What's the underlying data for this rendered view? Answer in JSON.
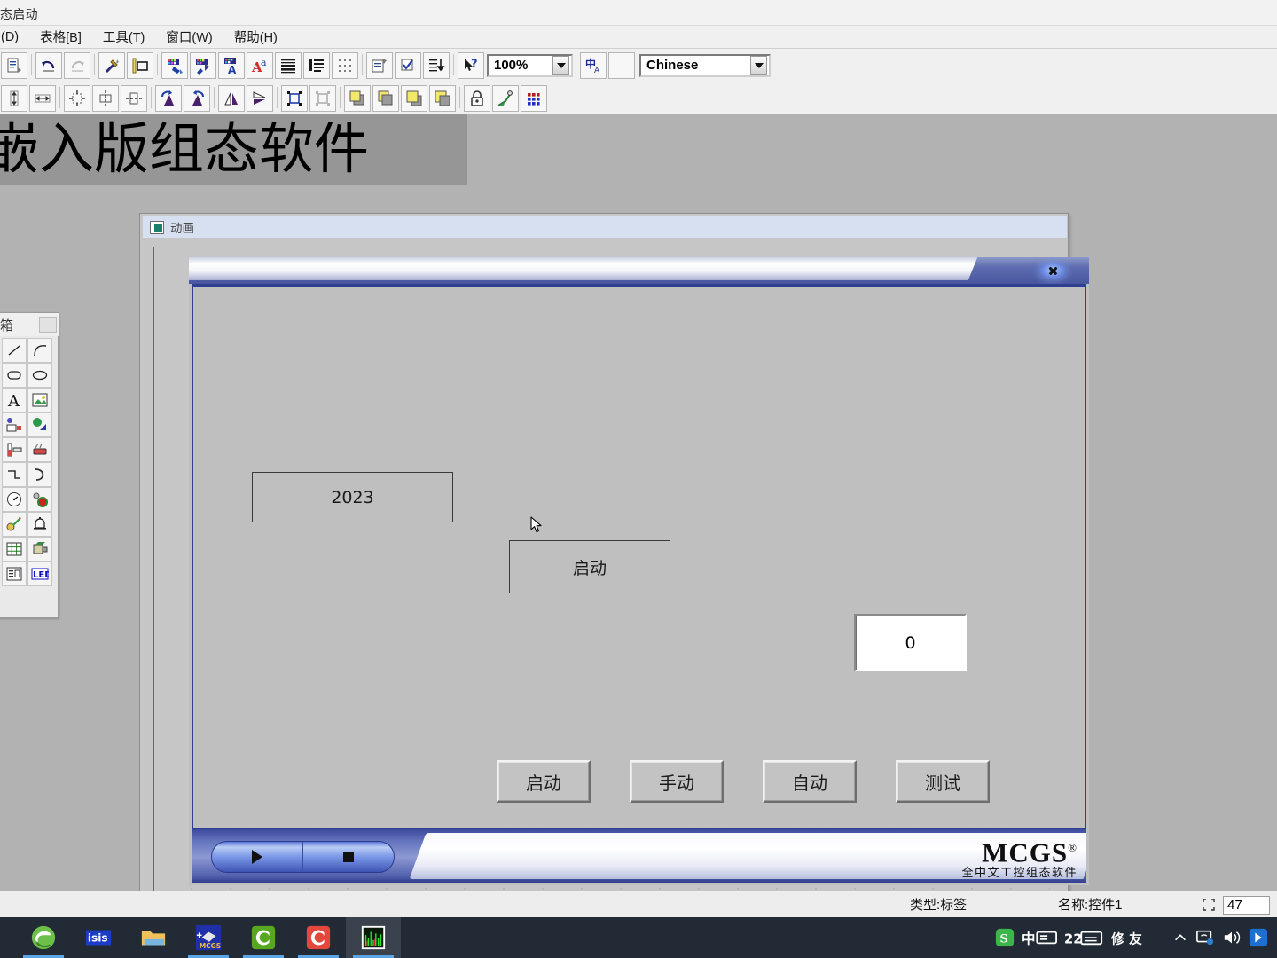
{
  "app": {
    "title": "态启动",
    "menu": [
      "(D)",
      "表格[B]",
      "工具(T)",
      "窗口(W)",
      "帮助(H)"
    ]
  },
  "toolbar": {
    "row1_icons": [
      "copy-page-icon",
      "undo-icon",
      "redo-icon",
      "tools-hammer-icon",
      "frame-ruler-icon",
      "fill-color-icon",
      "line-color-icon",
      "text-color-icon",
      "font-style-icon",
      "text-align-block-icon",
      "text-align-list-icon",
      "grid-dots-icon",
      "properties-icon",
      "check-script-icon",
      "sort-list-icon",
      "help-pointer-icon"
    ],
    "zoom_value": "100%",
    "ime_icon": "chinese-ime-icon",
    "language_value": "Chinese",
    "row2_icons": [
      "size-height-icon",
      "size-width-icon",
      "align-center-both-icon",
      "align-center-horizontal-icon",
      "align-center-vertical-icon",
      "rotate-left-icon",
      "rotate-right-icon",
      "flip-horizontal-icon",
      "flip-vertical-icon",
      "group-icon",
      "ungroup-icon",
      "bring-front-icon",
      "send-back-icon",
      "bring-forward-icon",
      "send-backward-icon",
      "lock-icon",
      "unlock-icon",
      "color-palette-icon"
    ]
  },
  "banner": {
    "text": "嵌入版组态软件"
  },
  "editor_window": {
    "icon": "animation-window-icon",
    "title": "动画"
  },
  "toolbox": {
    "title": "具箱",
    "items": [
      {
        "name": "line-tool",
        "glyph": "line-icon"
      },
      {
        "name": "arc-tool",
        "glyph": "arc-icon"
      },
      {
        "name": "rounded-rect-tool",
        "glyph": "rounded-rect-icon"
      },
      {
        "name": "ellipse-tool",
        "glyph": "ellipse-icon"
      },
      {
        "name": "text-tool",
        "glyph": "letter-a-icon"
      },
      {
        "name": "picture-tool",
        "glyph": "picture-icon"
      },
      {
        "name": "input-box-tool",
        "glyph": "input-box-icon"
      },
      {
        "name": "flow-block-tool",
        "glyph": "flow-block-icon"
      },
      {
        "name": "slider-tool",
        "glyph": "slider-icon"
      },
      {
        "name": "tank-tool",
        "glyph": "tank-icon"
      },
      {
        "name": "pipe-tool",
        "glyph": "pipe-icon"
      },
      {
        "name": "elbow-tool",
        "glyph": "elbow-icon"
      },
      {
        "name": "meter-tool",
        "glyph": "meter-icon"
      },
      {
        "name": "indicator-lamp-tool",
        "glyph": "lamp-icon"
      },
      {
        "name": "valve-tool",
        "glyph": "valve-icon"
      },
      {
        "name": "alarm-bell-tool",
        "glyph": "bell-icon"
      },
      {
        "name": "table-tool",
        "glyph": "table-icon"
      },
      {
        "name": "motor-tool",
        "glyph": "motor-icon"
      },
      {
        "name": "report-tool",
        "glyph": "report-icon"
      },
      {
        "name": "led-display-tool",
        "glyph": "led-icon"
      }
    ]
  },
  "dialog": {
    "close_label": "×",
    "year_label": "2023",
    "start_label": "启动",
    "value_display": "0",
    "buttons": [
      {
        "name": "start",
        "label": "启动"
      },
      {
        "name": "manual",
        "label": "手动"
      },
      {
        "name": "auto",
        "label": "自动"
      },
      {
        "name": "test",
        "label": "测试"
      }
    ],
    "footer": {
      "run_icon": "play-icon",
      "stop_icon": "stop-icon",
      "brand": "MCGS",
      "registered": "®",
      "tagline": "全中文工控组态软件"
    }
  },
  "statusbar": {
    "type_text": "类型:标签",
    "name_text": "名称:控件1",
    "selection_icon": "selection-bounds-icon",
    "field_value": "47"
  },
  "taskbar": {
    "apps": [
      {
        "name": "edge-browser",
        "glyph": "e",
        "color": "#6cc04a",
        "active": false,
        "running": false
      },
      {
        "name": "isis-proteus",
        "glyph": "isis",
        "color": "#1a3cc8",
        "active": false,
        "running": false
      },
      {
        "name": "file-explorer",
        "glyph": "folder",
        "color": "#f0c05a",
        "active": false,
        "running": false
      },
      {
        "name": "mcgs-configuration",
        "glyph": "mcgs",
        "color": "#1f2fa8",
        "active": false,
        "running": true
      },
      {
        "name": "keil-green",
        "glyph": "C",
        "color": "#57a721",
        "active": false,
        "running": true
      },
      {
        "name": "keil-red",
        "glyph": "C",
        "color": "#e4483c",
        "active": false,
        "running": true
      },
      {
        "name": "mcgs-runtime",
        "glyph": "wave",
        "color": "#0f2a0f",
        "active": true,
        "running": true
      }
    ],
    "tray": [
      {
        "name": "sogou-ime",
        "glyph": "S"
      },
      {
        "name": "ime-chinese",
        "glyph": "中"
      },
      {
        "name": "ime-keyboard",
        "glyph": "22"
      },
      {
        "name": "ime-toolbox",
        "glyph": "修"
      },
      {
        "name": "show-hidden-icons",
        "glyph": "^"
      },
      {
        "name": "network-status",
        "glyph": "net"
      },
      {
        "name": "volume",
        "glyph": "vol"
      },
      {
        "name": "action-center",
        "glyph": "ac"
      }
    ]
  },
  "colors": {
    "dialog_face": "#bfbfbf",
    "dialog_border": "#2e3f8f",
    "mcgs_blue": "#48579f",
    "taskbar": "#222b35",
    "accent": "#5ba4e5"
  }
}
